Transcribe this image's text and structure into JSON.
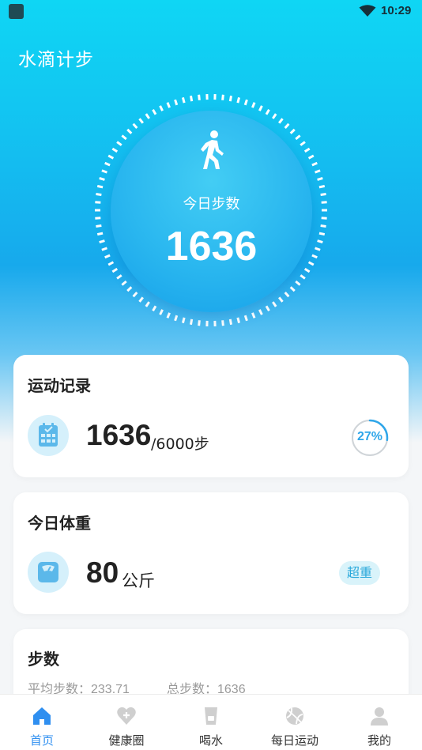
{
  "status_bar": {
    "time": "10:29"
  },
  "app": {
    "title": "水滴计步"
  },
  "hero": {
    "label": "今日步数",
    "steps": "1636"
  },
  "exercise_card": {
    "title": "运动记录",
    "steps": "1636",
    "goal": "/6000步",
    "progress_text": "27%",
    "progress_fraction": 0.27,
    "icon": "calendar-icon"
  },
  "weight_card": {
    "title": "今日体重",
    "value": "80",
    "unit": "公斤",
    "badge": "超重",
    "icon": "scale-icon"
  },
  "steps_card": {
    "title": "步数",
    "average": "平均步数：233.71",
    "total": "总步数：1636"
  },
  "tabbar": {
    "tabs": [
      {
        "label": "首页",
        "icon": "home-icon",
        "active": true
      },
      {
        "label": "健康圈",
        "icon": "heart-plus-icon",
        "active": false
      },
      {
        "label": "喝水",
        "icon": "cup-icon",
        "active": false
      },
      {
        "label": "每日运动",
        "icon": "ball-icon",
        "active": false
      },
      {
        "label": "我的",
        "icon": "person-icon",
        "active": false
      }
    ]
  },
  "colors": {
    "accent": "#2f8ff0",
    "hero_top": "#0fd6f4",
    "hero_bottom": "#159fe9",
    "progress": "#2fa6e9",
    "badge_bg": "#d9f3fa"
  }
}
